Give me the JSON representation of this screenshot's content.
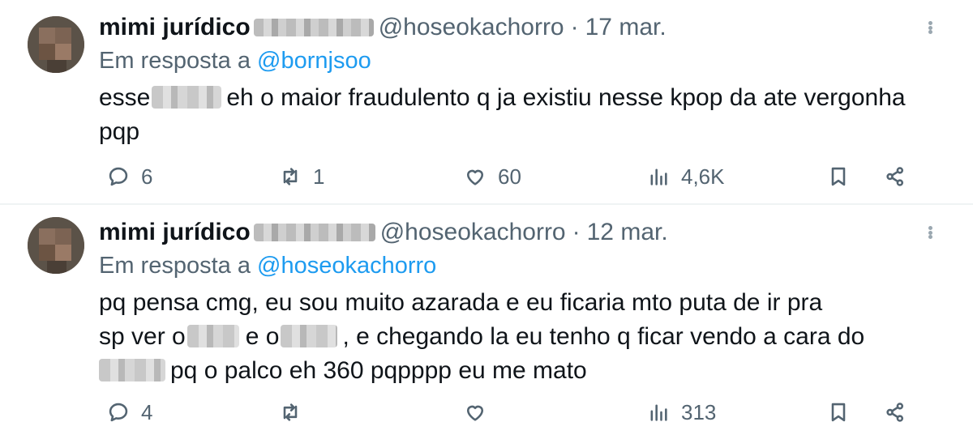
{
  "tweets": [
    {
      "name": "mimi jurídico",
      "handle": "@hoseokachorro",
      "dot": "·",
      "time": "17 mar.",
      "reply_prefix": "Em resposta a ",
      "reply_to": "@bornjsoo",
      "text": {
        "p1": "esse",
        "p2": "eh o maior fraudulento q ja existiu nesse kpop da ate vergonha pqp"
      },
      "replies": "6",
      "retweets": "1",
      "likes": "60",
      "views": "4,6K"
    },
    {
      "name": "mimi jurídico",
      "handle": "@hoseokachorro",
      "dot": "·",
      "time": "12 mar.",
      "reply_prefix": "Em resposta a ",
      "reply_to": "@hoseokachorro",
      "text": {
        "line1": "pq pensa cmg, eu sou muito azarada e eu ficaria mto puta de ir pra",
        "l2a": "sp ver o",
        "l2b": "e o",
        "l2c": ", e chegando la eu tenho q ficar vendo a cara do",
        "l3": "pq o palco eh 360 pqpppp eu me mato"
      },
      "replies": "4",
      "retweets": "",
      "likes": "",
      "views": "313"
    }
  ],
  "icons": {
    "reply": "reply-icon",
    "retweet": "retweet-icon",
    "like": "heart-icon",
    "views": "views-icon",
    "bookmark": "bookmark-icon",
    "share": "share-icon",
    "more": "more-icon"
  },
  "colors": {
    "text": "#0f1419",
    "secondary": "#536471",
    "link": "#1d9bf0",
    "divider": "#eff3f4"
  }
}
